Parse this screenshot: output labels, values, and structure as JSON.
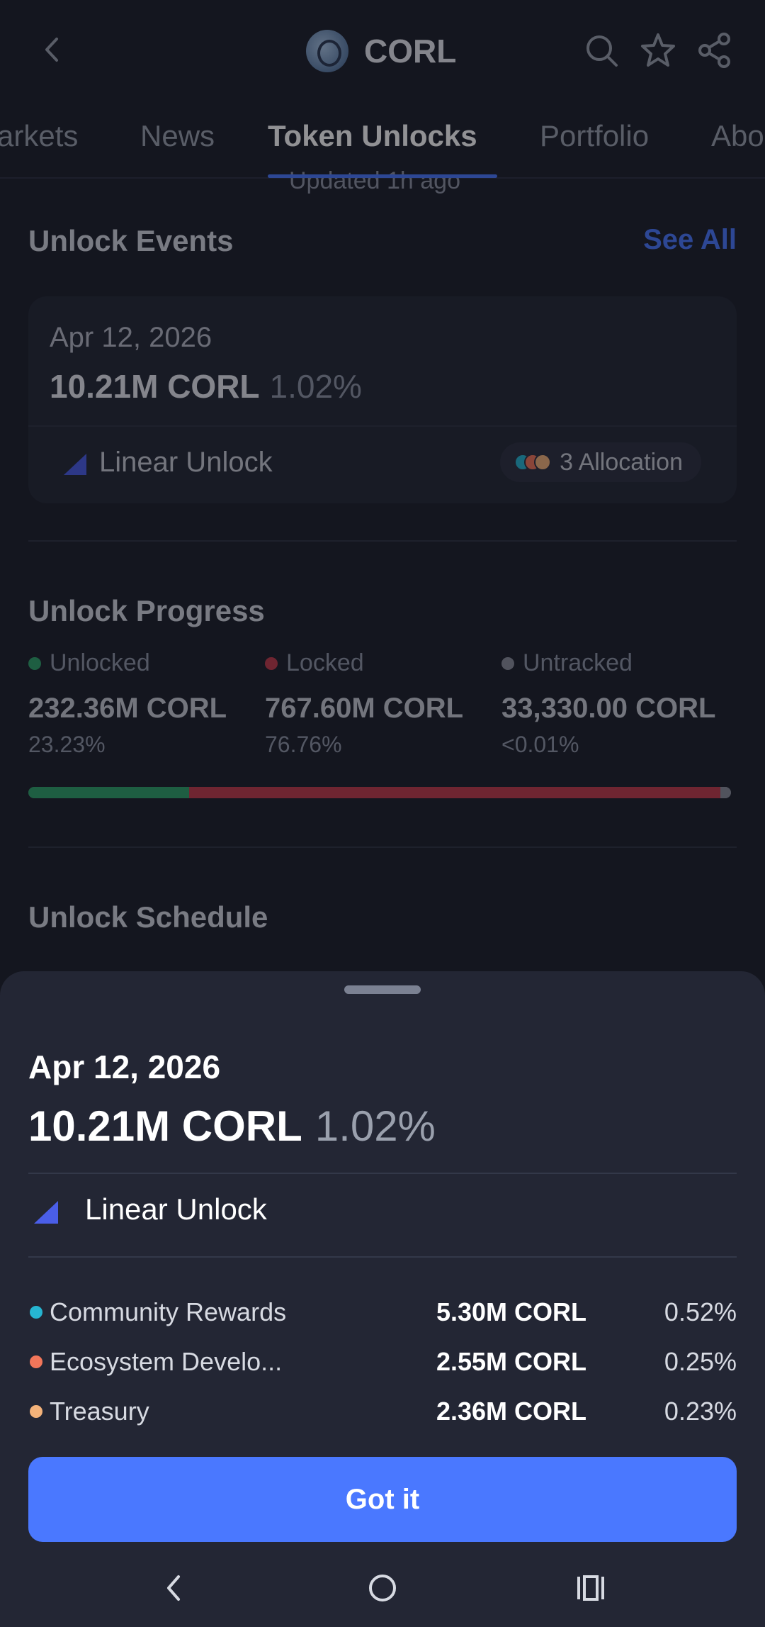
{
  "header": {
    "title": "CORL",
    "back_icon": "chevron-left-icon",
    "actions": [
      "search-icon",
      "star-icon",
      "share-icon"
    ]
  },
  "tabs": {
    "items": [
      {
        "label": "Markets",
        "visible_label": "arkets"
      },
      {
        "label": "News"
      },
      {
        "label": "Token Unlocks",
        "active": true
      },
      {
        "label": "Portfolio"
      },
      {
        "label": "About",
        "visible_label": "Abo"
      }
    ]
  },
  "updated_text": "Updated 1h ago",
  "unlock_events": {
    "title": "Unlock Events",
    "see_all": "See All",
    "card": {
      "date": "Apr 12, 2026",
      "amount": "10.21M CORL",
      "percent": "1.02%",
      "type": "Linear Unlock",
      "allocation": "3 Allocation"
    }
  },
  "unlock_progress": {
    "title": "Unlock Progress",
    "columns": [
      {
        "label": "Unlocked",
        "amount": "232.36M CORL",
        "percent": "23.23%",
        "color": "#2ea36b"
      },
      {
        "label": "Locked",
        "amount": "767.60M CORL",
        "percent": "76.76%",
        "color": "#c23b4b"
      },
      {
        "label": "Untracked",
        "amount": "33,330.00 CORL",
        "percent": "<0.01%",
        "color": "#8a8f9c"
      }
    ],
    "bar_fractions": {
      "unlocked": 0.2323,
      "locked": 0.7676,
      "untracked": 0.0001
    }
  },
  "unlock_schedule": {
    "title": "Unlock Schedule"
  },
  "sheet": {
    "date": "Apr 12, 2026",
    "amount": "10.21M CORL",
    "percent": "1.02%",
    "type": "Linear Unlock",
    "rows": [
      {
        "name": "Community Rewards",
        "amount": "5.30M CORL",
        "percent": "0.52%",
        "color": "#26b5d1"
      },
      {
        "name": "Ecosystem Develo...",
        "amount": "2.55M CORL",
        "percent": "0.25%",
        "color": "#f2765a"
      },
      {
        "name": "Treasury",
        "amount": "2.36M CORL",
        "percent": "0.23%",
        "color": "#f3b27a"
      }
    ],
    "button": "Got it"
  },
  "colors": {
    "accent": "#4a78ff",
    "background": "#1c1f2a",
    "sheet": "#232634"
  },
  "navbar": [
    "back-nav-icon",
    "home-nav-icon",
    "recents-nav-icon"
  ]
}
